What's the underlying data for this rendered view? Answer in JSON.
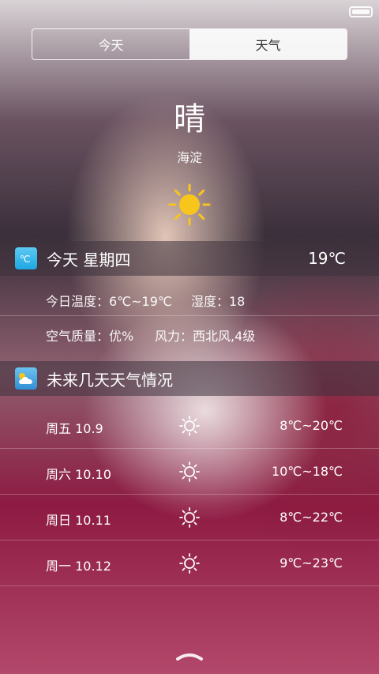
{
  "tabs": [
    {
      "label": "今天",
      "selected": false
    },
    {
      "label": "天气",
      "selected": true
    }
  ],
  "current": {
    "condition": "晴",
    "location": "海淀",
    "icon": "sun-icon"
  },
  "today": {
    "title": "今天 星期四",
    "temp": "19℃",
    "icon": "thermometer-celsius-icon",
    "temp_range": "今日温度：6℃~19℃",
    "humidity": "湿度：18",
    "air_quality": "空气质量：优%",
    "wind": "风力：西北风,4级"
  },
  "forecast": {
    "title": "未来几天天气情况",
    "icon": "cloud-icon",
    "days": [
      {
        "day": "周五 10.9",
        "range": "8℃~20℃",
        "icon": "sun-outline-icon"
      },
      {
        "day": "周六 10.10",
        "range": "10℃~18℃",
        "icon": "sun-outline-icon"
      },
      {
        "day": "周日 10.11",
        "range": "8℃~22℃",
        "icon": "sun-outline-icon"
      },
      {
        "day": "周一 10.12",
        "range": "9℃~23℃",
        "icon": "sun-outline-icon"
      }
    ]
  },
  "colors": {
    "sun": "#f7c51b",
    "accent_blue": "#1ea7e3",
    "header_bg": "rgba(60,50,60,0.55)"
  }
}
